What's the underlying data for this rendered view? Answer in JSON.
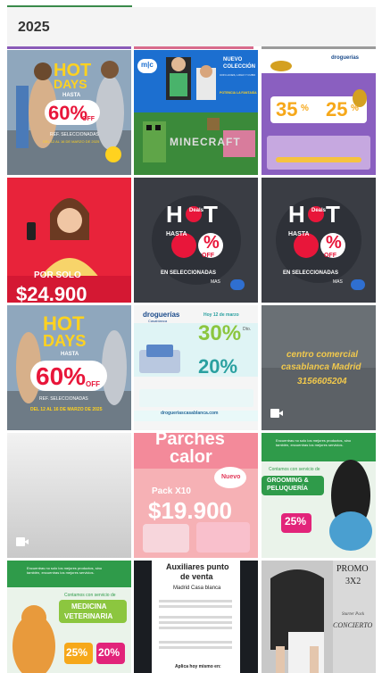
{
  "header": {
    "year": "2025"
  },
  "colors": {
    "accent_green": "#3a8a4a",
    "purple_tab": "#8a5bb8",
    "pink_tab": "#d86b8c",
    "gray_tab": "#9b9b9b"
  },
  "tiles": {
    "hotdays1": {
      "hot": "HOT",
      "days": "DAYS",
      "hasta": "HASTA",
      "pct": "60%",
      "off": "OFF",
      "ref": "REF. SELECCIONADAS",
      "dates": "DEL 12 AL 16 DE MARZO DE 2025"
    },
    "minecraft": {
      "logo": "m|c",
      "nuevo": "NUEVO",
      "coleccion": "COLECCIÓN",
      "sub": "CON LUCES, LOGO Y CUBO",
      "fantasia": "POTENCIA LA FANTASÍA",
      "game": "MINECRAFT"
    },
    "promo35": {
      "brand": "droguerías",
      "p35": "35",
      "p25": "25",
      "unit": "%"
    },
    "porsolo": {
      "label": "POR SOLO",
      "price": "$24.900"
    },
    "hotdeals1": {
      "hot": "H",
      "t": "T",
      "deals": "Deals",
      "hasta": "HASTA",
      "pct": "%",
      "off": "OFF",
      "en": "EN SELECCIONADAS",
      "mas": "MAS"
    },
    "hotdeals2": {
      "hot": "H",
      "t": "T",
      "deals": "Deals",
      "hasta": "HASTA",
      "pct": "%",
      "off": "OFF",
      "en": "EN SELECCIONADAS",
      "mas": "MAS"
    },
    "hotdays2": {
      "hot": "HOT",
      "days": "DAYS",
      "hasta": "HASTA",
      "pct": "60%",
      "off": "OFF",
      "ref": "REF. SELECCIONADAS",
      "dates": "DEL 12 AL 16 DE MARZO DE 2025"
    },
    "drogueria": {
      "brand": "droguerías",
      "brand2": "Casablanca",
      "hoy": "Hoy 12 de marzo",
      "p30": "30%",
      "p20": "20%",
      "dto": "Dto.",
      "url": "drogueriascasablanca.com"
    },
    "centro": {
      "line1": "centro comercial",
      "line2": "casablanca Madrid",
      "phone": "3156605204"
    },
    "parches": {
      "title1": "Parches",
      "title2": "calor",
      "nuevo": "Nuevo",
      "pack": "Pack X10",
      "price": "$19.900"
    },
    "grooming": {
      "header": "Encuentras no solo los mejores productos, sino también, encuentras los mejores servicios.",
      "contamos": "Contamos con servicio de",
      "service1": "GROOMING &",
      "service2": "PELUQUERÍA",
      "pct": "25%"
    },
    "veterinaria": {
      "header": "Encuentras no solo los mejores productos, sino también, encuentras los mejores servicios.",
      "contamos": "Contamos con servicio de",
      "service1": "MEDICINA",
      "service2": "VETERINARIA",
      "p25": "25%",
      "p20": "20%"
    },
    "auxiliares": {
      "title1": "Auxiliares punto",
      "title2": "de venta",
      "loc": "Madrid Casa blanca",
      "apply": "Aplica hoy mismo en:"
    },
    "promo3x2": {
      "promo": "PROMO",
      "x": "3X2",
      "starter": "Starter Pack",
      "concierto": "CONCIERTO"
    }
  }
}
